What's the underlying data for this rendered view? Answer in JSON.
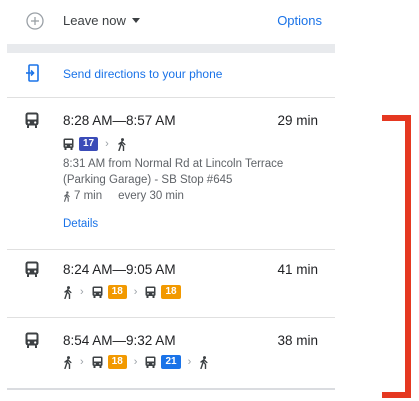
{
  "topbar": {
    "add_icon": "add-circle-icon",
    "leave_label": "Leave now",
    "options_label": "Options"
  },
  "send": {
    "icon": "phone-send-icon",
    "label": "Send directions to your phone"
  },
  "routes": [
    {
      "icon": "transit-icon",
      "times": "8:28 AM—8:57 AM",
      "duration": "29 min",
      "steps": [
        {
          "type": "bus",
          "line": "17",
          "color": "#3b4cb8"
        },
        {
          "type": "walk"
        }
      ],
      "depart": "8:31 AM from Normal Rd at Lincoln Terrace (Parking Garage) - SB Stop #645",
      "walk_time": "7 min",
      "frequency": "every 30 min",
      "details_label": "Details"
    },
    {
      "icon": "transit-icon",
      "times": "8:24 AM—9:05 AM",
      "duration": "41 min",
      "steps": [
        {
          "type": "walk"
        },
        {
          "type": "bus",
          "line": "18",
          "color": "#f29900"
        },
        {
          "type": "bus",
          "line": "18",
          "color": "#f29900"
        }
      ]
    },
    {
      "icon": "transit-icon",
      "times": "8:54 AM—9:32 AM",
      "duration": "38 min",
      "steps": [
        {
          "type": "walk"
        },
        {
          "type": "bus",
          "line": "18",
          "color": "#f29900"
        },
        {
          "type": "bus",
          "line": "21",
          "color": "#1a73e8"
        },
        {
          "type": "walk"
        }
      ]
    }
  ],
  "annotation": {
    "color": "#e53821"
  }
}
